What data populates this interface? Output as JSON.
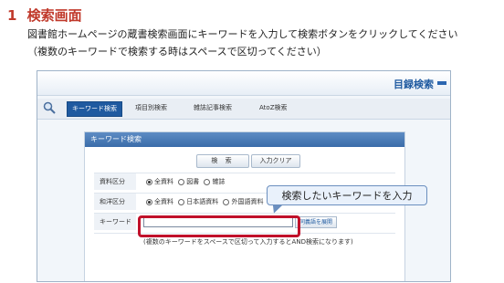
{
  "heading": {
    "number": "1",
    "title": "検索画面"
  },
  "description": {
    "line1": "図書館ホームページの蔵書検索画面にキーワードを入力して検索ボタンをクリックしてください",
    "line2": "（複数のキーワードで検索する時はスペースで区切ってください）"
  },
  "screenshot": {
    "header_title": "目録検索",
    "tabs": [
      "キーワード検索",
      "項目別検索",
      "雑誌記事検索",
      "AtoZ検索"
    ],
    "panel_title": "キーワード検索",
    "search_button": "検 索",
    "clear_button": "入力クリア",
    "rows": {
      "material": {
        "label": "資料区分",
        "options": [
          "全資料",
          "図書",
          "雑誌"
        ],
        "selected": "全資料"
      },
      "language": {
        "label": "和洋区分",
        "options": [
          "全資料",
          "日本語資料",
          "外国語資料"
        ],
        "selected": "全資料"
      },
      "keyword": {
        "label": "キーワード",
        "value": "",
        "side_button": "同義語を展開"
      },
      "note": "(複数のキーワードをスペースで区切って入力するとAND検索になります)"
    }
  },
  "callout": {
    "text": "検索したいキーワードを入力"
  },
  "colors": {
    "heading": "#c0392b",
    "highlight": "#c0102a",
    "accent": "#1f5aa0"
  },
  "icons": [
    "magnifier-icon"
  ]
}
